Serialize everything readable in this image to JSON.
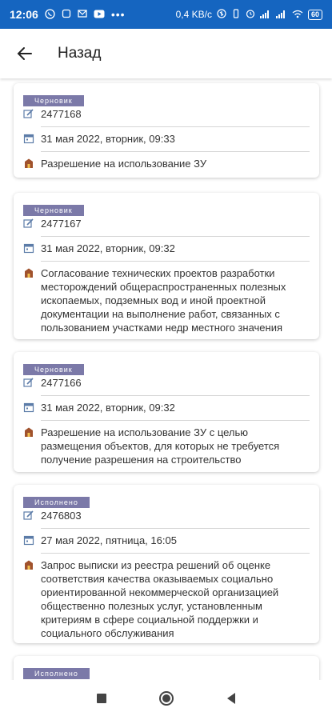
{
  "status_bar": {
    "time": "12:06",
    "network_speed": "0,4 KB/c",
    "battery": "60"
  },
  "app_bar": {
    "back_icon": "arrow-left-icon",
    "title": "Назад"
  },
  "cards": [
    {
      "status": "Черновик",
      "number": "2477168",
      "date": "31 мая 2022, вторник, 09:33",
      "service_lines": [
        "Разрешение на использование ЗУ"
      ]
    },
    {
      "status": "Черновик",
      "number": "2477167",
      "date": "31 мая 2022, вторник, 09:32",
      "service_lines": [
        "Согласование технических проектов разработки",
        "месторождений общераспространенных полезных",
        "ископаемых, подземных вод и иной проектной",
        "документации на выполнение работ, связанных с",
        "пользованием участками недр местного значения"
      ]
    },
    {
      "status": "Черновик",
      "number": "2477166",
      "date": "31 мая 2022, вторник, 09:32",
      "service_lines": [
        "Разрешение на использование ЗУ с целью",
        "размещения объектов, для которых не требуется",
        "получение разрешения на строительство"
      ]
    },
    {
      "status": "Исполнено",
      "number": "2476803",
      "date": "27 мая 2022, пятница, 16:05",
      "service_lines": [
        "Запрос выписки из реестра решений об оценке",
        "соответствия качества оказываемых социально",
        "ориентированной некоммерческой организацией",
        "общественно полезных услуг, установленным",
        "критериям в сфере социальной поддержки и",
        "социального обслуживания"
      ]
    },
    {
      "status": "Исполнено"
    }
  ],
  "colors": {
    "status_bar": "#1565c0",
    "badge": "#7b79a8",
    "icon_blue": "#5c7ca8",
    "icon_brown": "#a0522d"
  }
}
